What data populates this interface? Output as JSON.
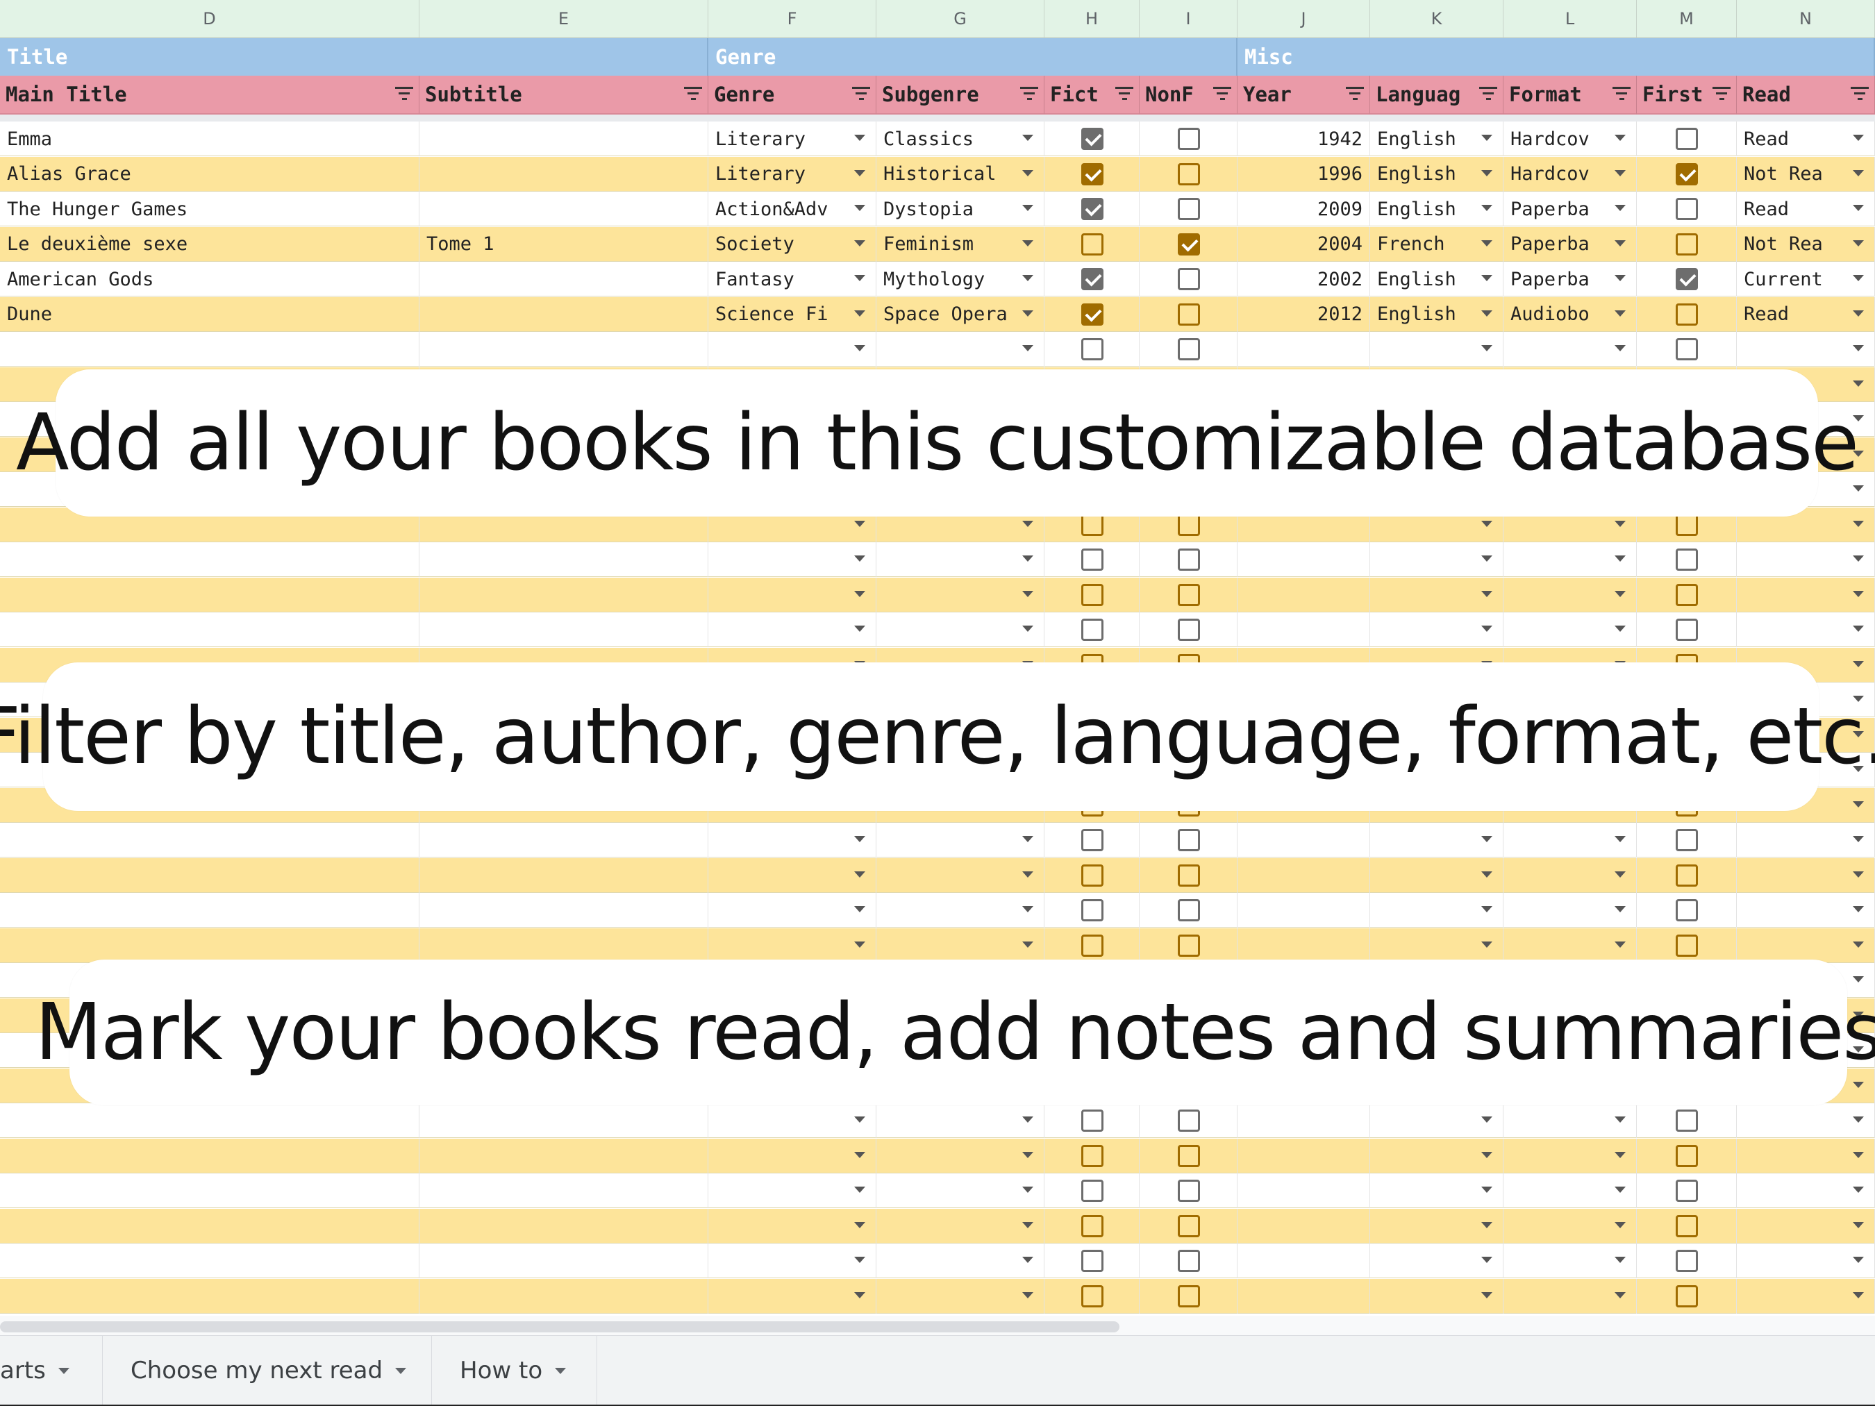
{
  "column_letters": [
    "D",
    "E",
    "F",
    "G",
    "H",
    "I",
    "J",
    "K",
    "L",
    "M",
    "N"
  ],
  "groups": [
    {
      "label": "Title"
    },
    {
      "label": "Genre"
    },
    {
      "label": "Misc"
    }
  ],
  "headers": [
    "Main Title",
    "Subtitle",
    "Genre",
    "Subgenre",
    "Fict",
    "NonF",
    "Year",
    "Languag",
    "Format",
    "First",
    "Read"
  ],
  "books": [
    {
      "title": "Emma",
      "subtitle": "",
      "genre": "Literary",
      "subgenre": "Classics",
      "fiction": true,
      "nonfiction": false,
      "year": "1942",
      "language": "English",
      "format": "Hardcov",
      "first": false,
      "read": "Read"
    },
    {
      "title": "Alias Grace",
      "subtitle": "",
      "genre": "Literary",
      "subgenre": "Historical",
      "fiction": true,
      "nonfiction": false,
      "year": "1996",
      "language": "English",
      "format": "Hardcov",
      "first": true,
      "read": "Not Rea"
    },
    {
      "title": "The Hunger Games",
      "subtitle": "",
      "genre": "Action&Adv",
      "subgenre": "Dystopia",
      "fiction": true,
      "nonfiction": false,
      "year": "2009",
      "language": "English",
      "format": "Paperba",
      "first": false,
      "read": "Read"
    },
    {
      "title": "Le deuxième sexe",
      "subtitle": "Tome 1",
      "genre": "Society",
      "subgenre": "Feminism",
      "fiction": false,
      "nonfiction": true,
      "year": "2004",
      "language": "French",
      "format": "Paperba",
      "first": false,
      "read": "Not Rea"
    },
    {
      "title": "American Gods",
      "subtitle": "",
      "genre": "Fantasy",
      "subgenre": "Mythology",
      "fiction": true,
      "nonfiction": false,
      "year": "2002",
      "language": "English",
      "format": "Paperba",
      "first": true,
      "read": "Current"
    },
    {
      "title": "Dune",
      "subtitle": "",
      "genre": "Science Fi",
      "subgenre": "Space Opera",
      "fiction": true,
      "nonfiction": false,
      "year": "2012",
      "language": "English",
      "format": "Audiobo",
      "first": false,
      "read": "Read"
    }
  ],
  "banners": [
    {
      "text": "Add all your books in this customizable database"
    },
    {
      "text": "Filter by title, author, genre, language, format, etc."
    },
    {
      "text": "Mark your books read, add notes and summaries"
    }
  ],
  "sheet_tabs": [
    {
      "label": "arts"
    },
    {
      "label": "Choose my next read"
    },
    {
      "label": "How to"
    }
  ],
  "colors": {
    "group_header": "#9fc5e8",
    "column_header": "#ea9aa8",
    "band_yellow": "#fde49a",
    "band_white": "#ffffff",
    "checkbox_gray": "#6d6d6d",
    "checkbox_gold": "#a06c00",
    "column_letter_bg": "#e2f3e6"
  }
}
